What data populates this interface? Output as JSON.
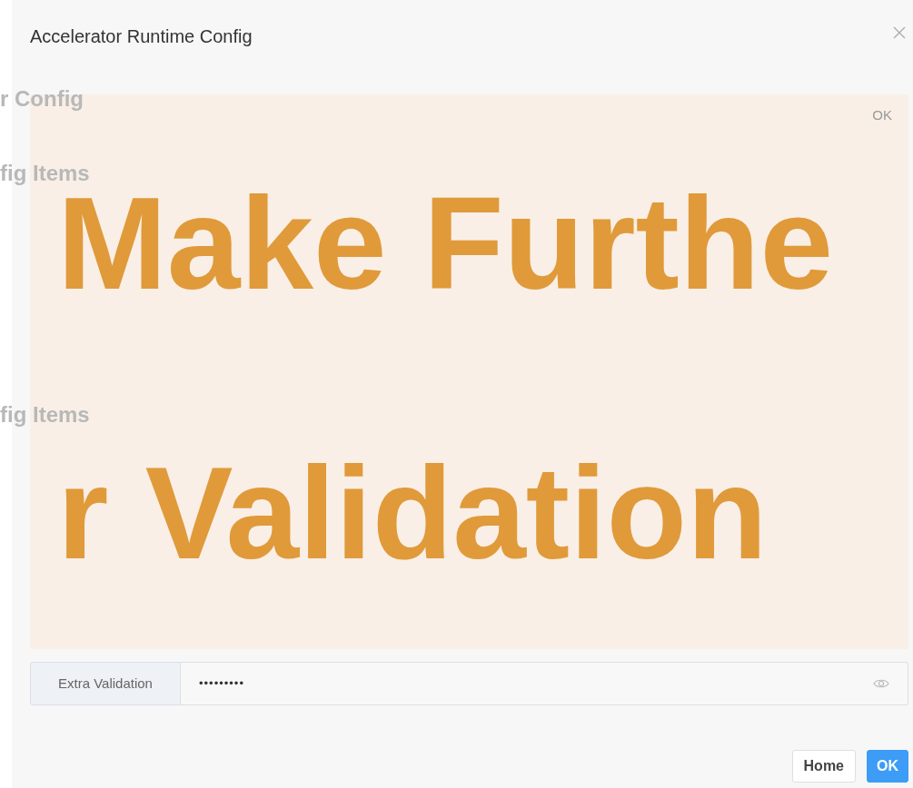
{
  "dialog": {
    "title": "Accelerator Runtime Config"
  },
  "background_headings": [
    "r Config",
    "fig Items",
    "fig Items"
  ],
  "banner": {
    "lines": [
      "Make Furthe",
      "r Validation"
    ],
    "corner_label": "OK"
  },
  "field": {
    "label": "Extra Validation",
    "value": "•••••••••"
  },
  "buttons": [
    {
      "label": "Home",
      "kind": "default"
    },
    {
      "label": "OK",
      "kind": "primary"
    }
  ]
}
